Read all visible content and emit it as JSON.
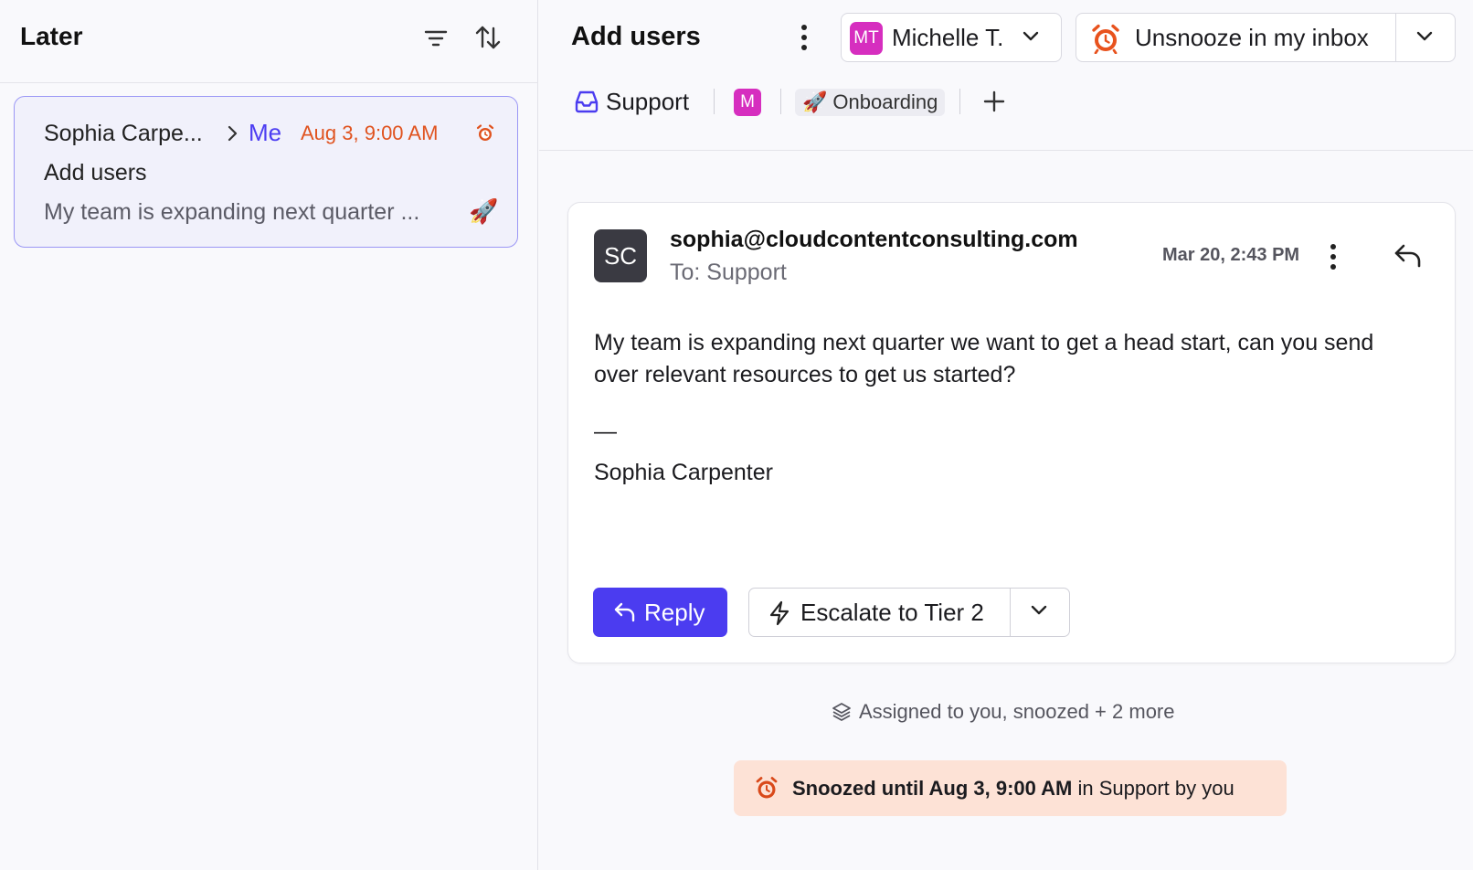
{
  "left_panel": {
    "title": "Later",
    "icons": [
      "filter-icon",
      "sort-icon"
    ],
    "conversation": {
      "sender": "Sophia Carpe...",
      "recipient": "Me",
      "snooze_date": "Aug 3, 9:00 AM",
      "subject": "Add users",
      "preview": "My team is expanding next quarter ...",
      "tag_emoji": "🚀"
    }
  },
  "header": {
    "title": "Add users",
    "assignee_initials": "MT",
    "assignee_name": "Michelle T.",
    "unsnooze_label": "Unsnooze in my inbox"
  },
  "tags": {
    "inbox": "Support",
    "member_initial": "M",
    "onboarding_emoji": "🚀",
    "onboarding_label": "Onboarding"
  },
  "message": {
    "avatar_initials": "SC",
    "from": "sophia@cloudcontentconsulting.com",
    "to": "To: Support",
    "date": "Mar 20, 2:43 PM",
    "body": "My team is expanding next quarter we want to get a head start, can you send over relevant resources to get us started?",
    "dash": "—",
    "signature": "Sophia Carpenter",
    "reply_label": "Reply",
    "escalate_label": "Escalate to Tier 2"
  },
  "activity": {
    "assigned_text": "Assigned to you, snoozed + 2 more",
    "snooze_bold": "Snoozed until Aug 3, 9:00 AM",
    "snooze_rest": " in Support by you"
  },
  "colors": {
    "accent": "#4b3cf0",
    "snooze_orange": "#e0531f",
    "badge_magenta": "#d62ebf",
    "snooze_banner": "#fde2d6"
  }
}
